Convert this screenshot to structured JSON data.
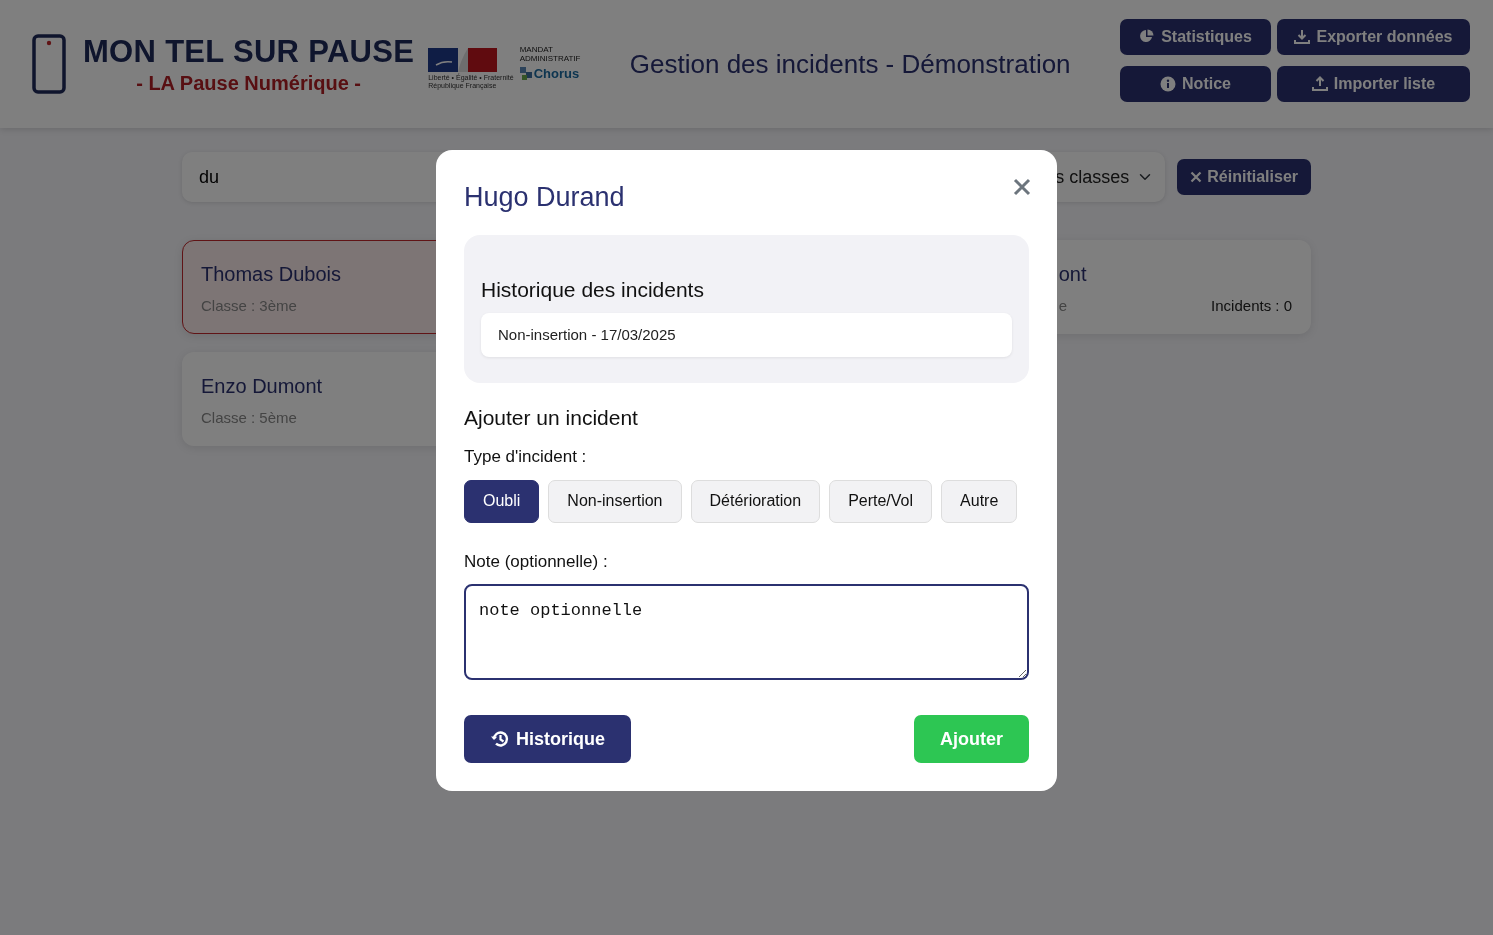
{
  "header": {
    "brand_title": "MON TEL SUR PAUSE",
    "brand_subtitle": "- LA Pause Numérique -",
    "gov_logo": {
      "motto": "Liberté • Égalité • Fraternité",
      "name": "République Française"
    },
    "chorus_logo": {
      "mandate_lines": [
        "MANDAT",
        "ADMINISTRATIF"
      ],
      "name": "Chorus"
    },
    "page_title": "Gestion des incidents - Démonstration",
    "buttons": [
      {
        "label": "Statistiques",
        "kind": "pie"
      },
      {
        "label": "Exporter données",
        "kind": "download"
      },
      {
        "label": "Notice",
        "kind": "info"
      },
      {
        "label": "Importer liste",
        "kind": "upload"
      }
    ]
  },
  "filters": {
    "search_value": "du",
    "class_select": "s classes",
    "reset_button": "Réinitialiser"
  },
  "students": [
    {
      "name": "Thomas Dubois",
      "class": "Classe : 3ème",
      "alert": true
    },
    {
      "name": "ont",
      "class": "e",
      "incidents": "Incidents : 0",
      "alert": false
    },
    {
      "name": "Enzo Dumont",
      "class": "Classe : 5ème",
      "alert": false
    }
  ],
  "modal": {
    "title": "Hugo Durand",
    "history": {
      "heading": "Historique des incidents",
      "items": [
        "Non-insertion - 17/03/2025"
      ]
    },
    "add_heading": "Ajouter un incident",
    "type_label": "Type d'incident :",
    "types": [
      {
        "label": "Oubli",
        "selected": true
      },
      {
        "label": "Non-insertion",
        "selected": false
      },
      {
        "label": "Détérioration",
        "selected": false
      },
      {
        "label": "Perte/Vol",
        "selected": false
      },
      {
        "label": "Autre",
        "selected": false
      }
    ],
    "note_label": "Note (optionnelle) :",
    "note_value": "note optionnelle",
    "history_button": "Historique",
    "submit_button": "Ajouter"
  }
}
